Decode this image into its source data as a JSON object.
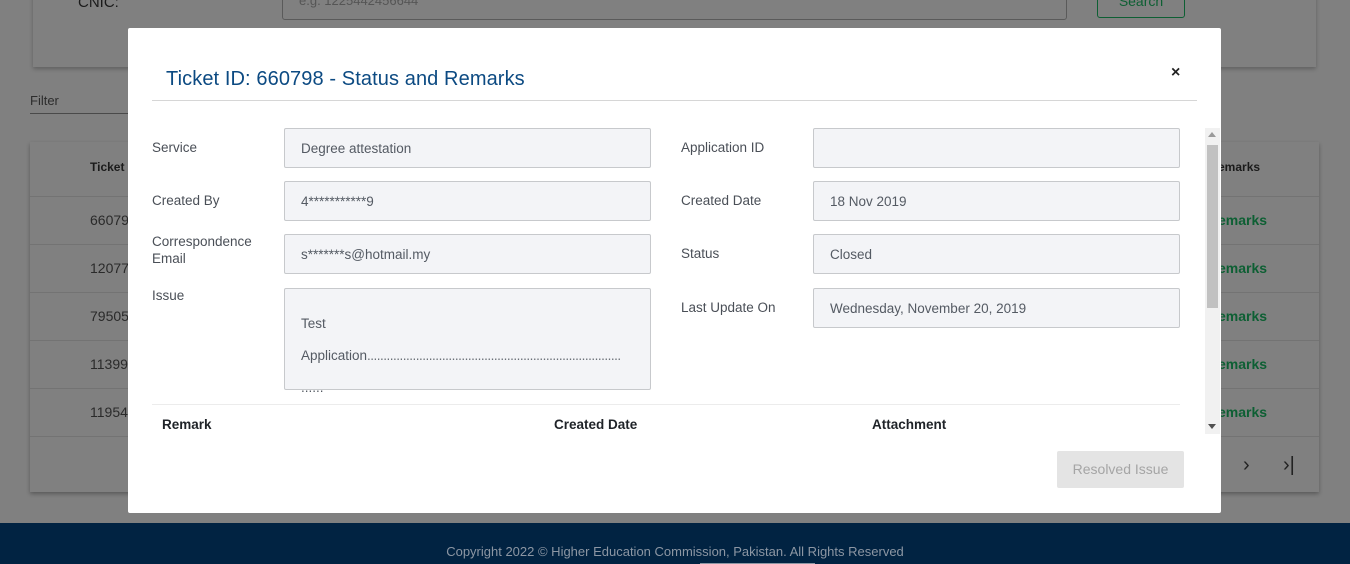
{
  "background": {
    "cnic_label": "CNIC:",
    "cnic_placeholder": "e.g. 1225442456644",
    "search_label": "Search",
    "filter_label": "Filter",
    "table": {
      "ticket_header": "Ticket I",
      "remarks_header": "emarks",
      "rows": [
        {
          "ticket": "66079",
          "remarks": "emarks"
        },
        {
          "ticket": "12077",
          "remarks": "emarks"
        },
        {
          "ticket": "79505",
          "remarks": "emarks"
        },
        {
          "ticket": "11399",
          "remarks": "emarks"
        },
        {
          "ticket": "11954",
          "remarks": "emarks"
        }
      ]
    },
    "pager_next": "›",
    "pager_last": "›|"
  },
  "modal": {
    "title": "Ticket ID: 660798 - Status and Remarks",
    "close": "×",
    "fields": {
      "service_label": "Service",
      "service_value": "Degree attestation",
      "application_id_label": "Application ID",
      "application_id_value": "",
      "created_by_label": "Created By",
      "created_by_value": "4***********9",
      "created_date_label": "Created Date",
      "created_date_value": "18 Nov 2019",
      "email_label": "Correspondence Email",
      "email_value": "s*******s@hotmail.my",
      "status_label": "Status",
      "status_value": "Closed",
      "issue_label": "Issue",
      "issue_line1": "Test",
      "issue_line2": "Application",
      "issue_line3": "......",
      "last_update_label": "Last Update On",
      "last_update_value": "Wednesday, November 20, 2019"
    },
    "remarks_table": {
      "headers": [
        "Remark",
        "Created Date",
        "Attachment"
      ]
    },
    "resolve_label": "Resolved Issue"
  },
  "footer": {
    "text": "Copyright 2022 © Higher Education Commission, Pakistan. All Rights Reserved"
  }
}
